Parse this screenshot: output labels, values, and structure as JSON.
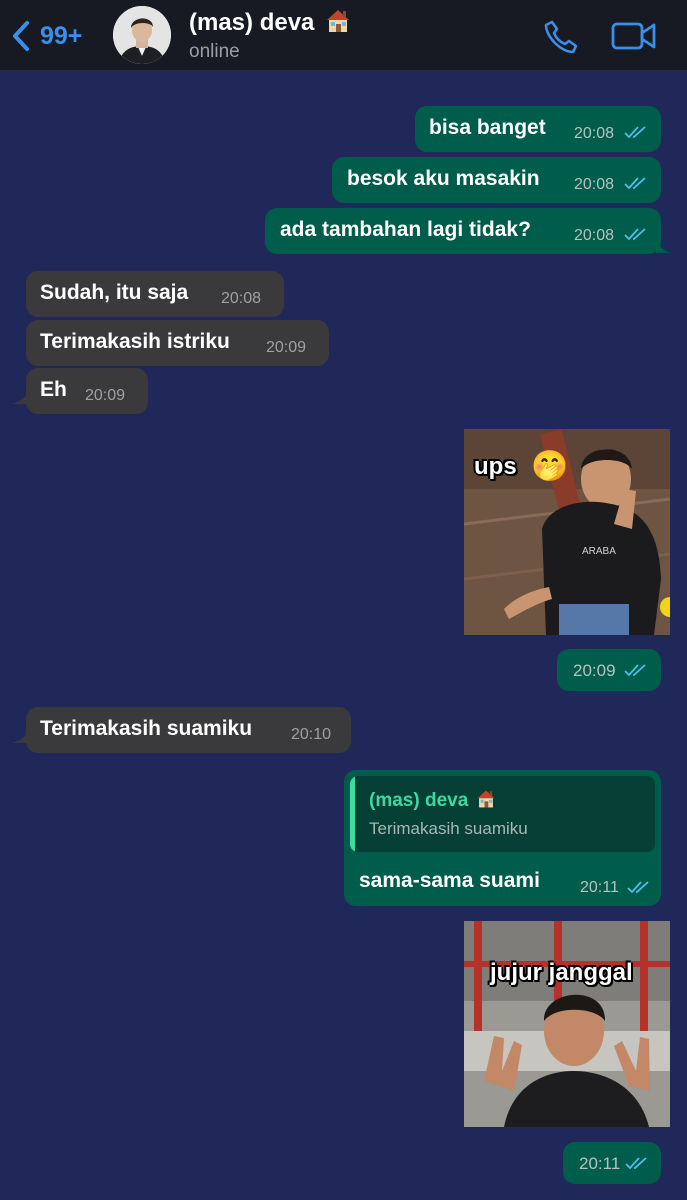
{
  "header": {
    "unread_count": "99+",
    "contact_name": "(mas) deva",
    "contact_status": "online"
  },
  "messages": [
    {
      "direction": "out",
      "text": "bisa banget",
      "time": "20:08",
      "status": "read"
    },
    {
      "direction": "out",
      "text": "besok aku masakin",
      "time": "20:08",
      "status": "read"
    },
    {
      "direction": "out",
      "text": "ada tambahan lagi tidak?",
      "time": "20:08",
      "status": "read"
    },
    {
      "direction": "in",
      "text": "Sudah, itu saja",
      "time": "20:08"
    },
    {
      "direction": "in",
      "text": "Terimakasih istriku",
      "time": "20:09"
    },
    {
      "direction": "in",
      "text": "Eh",
      "time": "20:09"
    },
    {
      "direction": "out",
      "type": "sticker",
      "caption": "ups",
      "caption_emoji": "🤭",
      "time": "20:09",
      "status": "read"
    },
    {
      "direction": "in",
      "text": "Terimakasih suamiku",
      "time": "20:10"
    },
    {
      "direction": "out",
      "text": "sama-sama suami",
      "time": "20:11",
      "status": "read",
      "reply_to": {
        "author": "(mas) deva",
        "text": "Terimakasih suamiku"
      }
    },
    {
      "direction": "out",
      "type": "sticker",
      "caption": "jujur janggal",
      "time": "20:11",
      "status": "read"
    }
  ],
  "colors": {
    "chat_background": "#20285a",
    "outgoing_bubble": "#005c4b",
    "incoming_bubble": "#3a3a3c",
    "accent_blue": "#3b8fe8",
    "read_tick": "#53bdeb",
    "reply_accent": "#3fd9a0"
  },
  "icons": [
    "back-chevron-icon",
    "house-icon",
    "phone-icon",
    "video-camera-icon",
    "double-check-icon"
  ]
}
